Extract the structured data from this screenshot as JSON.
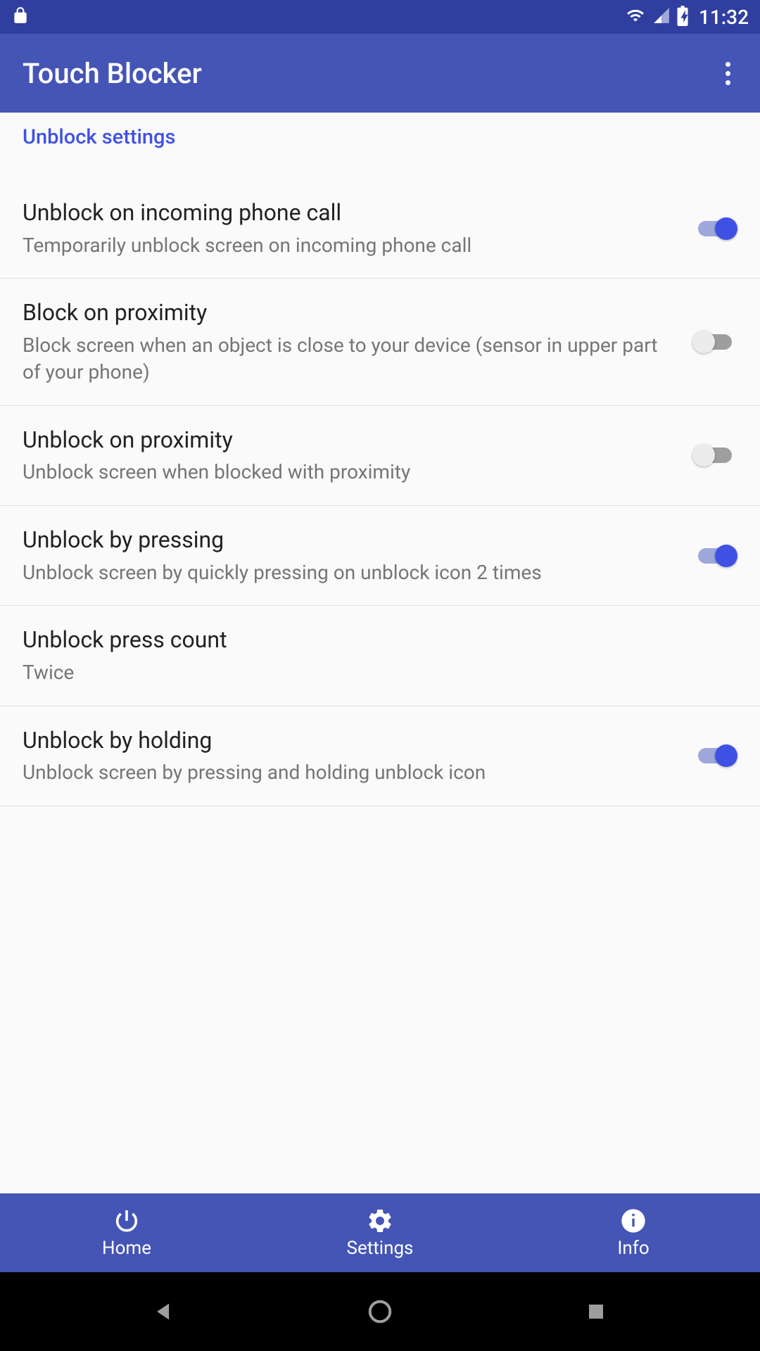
{
  "status": {
    "time": "11:32"
  },
  "app": {
    "title": "Touch Blocker"
  },
  "section": {
    "header": "Unblock settings"
  },
  "settings": [
    {
      "title": "Unblock on incoming phone call",
      "desc": "Temporarily unblock screen on incoming phone call",
      "on": true
    },
    {
      "title": "Block on proximity",
      "desc": "Block screen when an object is close to your device (sensor in upper part of your phone)",
      "on": false
    },
    {
      "title": "Unblock on proximity",
      "desc": "Unblock screen when blocked with proximity",
      "on": false
    },
    {
      "title": "Unblock by pressing",
      "desc": "Unblock screen by quickly pressing on unblock icon 2 times",
      "on": true
    },
    {
      "title": "Unblock press count",
      "desc": "Twice",
      "on": null
    },
    {
      "title": "Unblock by holding",
      "desc": "Unblock screen by pressing and holding unblock icon",
      "on": true
    }
  ],
  "nav": {
    "home": "Home",
    "settings": "Settings",
    "info": "Info"
  }
}
